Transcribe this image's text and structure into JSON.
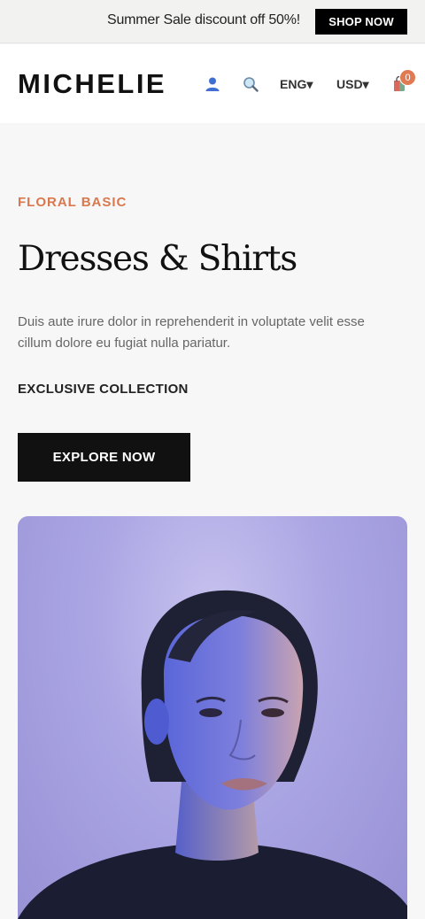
{
  "announcement": {
    "text": "Summer Sale discount off 50%!",
    "button_label": "SHOP NOW"
  },
  "header": {
    "logo": "MICHELIE",
    "language": "ENG▾",
    "currency": "USD▾",
    "cart_count": "0",
    "icons": [
      "user-icon",
      "search-icon",
      "cart-icon"
    ]
  },
  "hero": {
    "eyebrow": "FLORAL BASIC",
    "title": "Dresses & Shirts",
    "description": "Duis aute irure dolor in reprehenderit in voluptate velit esse cillum dolore eu fugiat nulla pariatur.",
    "collection_label": "EXCLUSIVE COLLECTION",
    "cta_label": "EXPLORE NOW"
  },
  "colors": {
    "accent": "#d9784e",
    "primary_button": "#111111",
    "badge": "#e07a52"
  }
}
